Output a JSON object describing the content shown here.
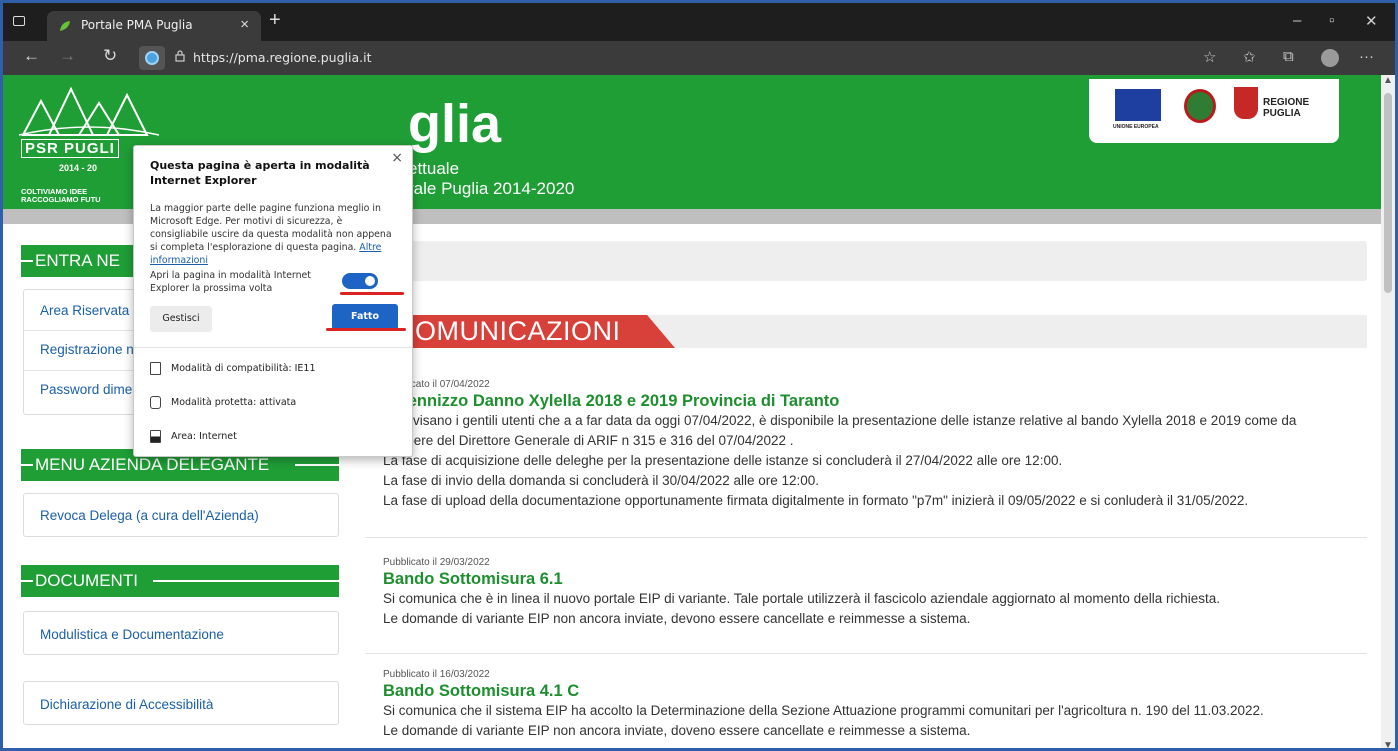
{
  "browser": {
    "tab_title": "Portale PMA Puglia",
    "tab_close": "×",
    "new_tab": "+",
    "url": "https://pma.regione.puglia.it",
    "win_min": "–",
    "win_restore": "▫",
    "win_close": "✕",
    "nav_back": "←",
    "nav_forward": "→",
    "nav_reload": "↻",
    "more": "···"
  },
  "banner": {
    "title": "glia",
    "subtitle1": "ettuale",
    "subtitle2": "rale Puglia 2014-2020",
    "logo_psr": "PSR PUGLI",
    "logo_year": "2014 - 20",
    "logo_motto1": "COLTIVIAMO IDEE",
    "logo_motto2": "RACCOGLIAMO FUTU",
    "eu_label": "UNIONE EUROPEA",
    "region1": "REGIONE",
    "region2": "PUGLIA"
  },
  "sidebar": {
    "section1_title": "ENTRA NE",
    "section1_items": [
      "Area Riservata",
      "Registrazione n",
      "Password dimenticata"
    ],
    "section2_title": "MENU AZIENDA DELEGANTE",
    "section2_items": [
      "Revoca Delega (a cura dell'Azienda)"
    ],
    "section3_title": "DOCUMENTI",
    "section3_items": [
      "Modulistica e Documentazione"
    ],
    "accessibility": "Dichiarazione di Accessibilità"
  },
  "main": {
    "crumb": "e",
    "section_title": "OMUNICAZIONI",
    "posts": [
      {
        "date": "Pubblicato il 07/04/2022",
        "title": "Indennizzo Danno Xylella 2018 e 2019 Provincia di Taranto",
        "lines": [
          "Si avvisano i gentili utenti che a a far data da oggi 07/04/2022, è disponibile la presentazione delle istanze relative al bando Xylella 2018 e 2019 come da",
          "Delibere del Direttore Generale di ARIF n 315 e 316 del 07/04/2022 .",
          "La fase di acquisizione delle deleghe per la presentazione delle istanze si concluderà il 27/04/2022 alle ore 12:00.",
          "La fase di invio della domanda si concluderà il 30/04/2022 alle ore 12:00.",
          "La fase di upload della documentazione opportunamente firmata digitalmente in formato \"p7m\" inizierà il 09/05/2022 e si conluderà il 31/05/2022."
        ]
      },
      {
        "date": "Pubblicato il 29/03/2022",
        "title": "Bando Sottomisura 6.1",
        "lines": [
          "Si comunica che è in linea il nuovo portale EIP di variante. Tale portale utilizzerà il fascicolo aziendale aggiornato al momento della richiesta.",
          "Le domande di variante EIP non ancora inviate, devono essere cancellate e reimmesse a sistema."
        ]
      },
      {
        "date": "Pubblicato il 16/03/2022",
        "title": "Bando Sottomisura 4.1 C",
        "lines": [
          "Si comunica che il sistema EIP ha accolto la Determinazione della Sezione Attuazione programmi comunitari per l'agricoltura n. 190 del 11.03.2022.",
          "Le domande di variante EIP non ancora inviate, doveno essere cancellate e reimmesse a sistema."
        ]
      }
    ]
  },
  "popup": {
    "close": "×",
    "heading": "Questa pagina è aperta in modalità Internet Explorer",
    "body": "La maggior parte delle pagine funziona meglio in Microsoft Edge. Per motivi di sicurezza, è consigliabile uscire da questa modalità non appena si completa l'esplorazione di questa pagina.",
    "link": "Altre informazioni",
    "toggle_label": "Apri la pagina in modalità Internet Explorer la prossima volta",
    "manage_button": "Gestisci",
    "done_button": "Fatto",
    "compat": "Modalità di compatibilità: IE11",
    "protected": "Modalità protetta: attivata",
    "zone": "Area: Internet"
  }
}
